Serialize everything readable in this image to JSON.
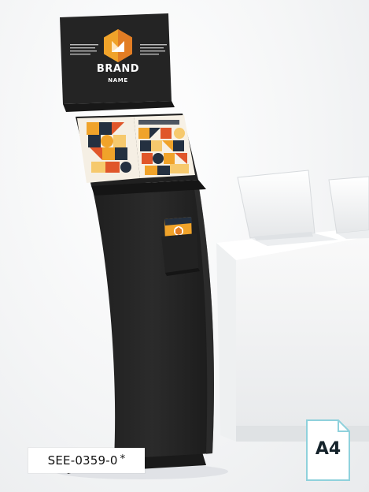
{
  "product": {
    "sku": "SEE-0359-0",
    "sku_mark": "*",
    "paper_size": "A4"
  },
  "header_sign": {
    "brand_title": "BRAND",
    "brand_subtitle": "NAME"
  },
  "colors": {
    "stand": "#262626",
    "logo_orange": "#f0a32a",
    "logo_dark_orange": "#e27d24",
    "badge_outline": "#8fd1dc",
    "counter": "#f7f7f7"
  },
  "icons": [
    "brand-logo-icon",
    "document-icon"
  ]
}
